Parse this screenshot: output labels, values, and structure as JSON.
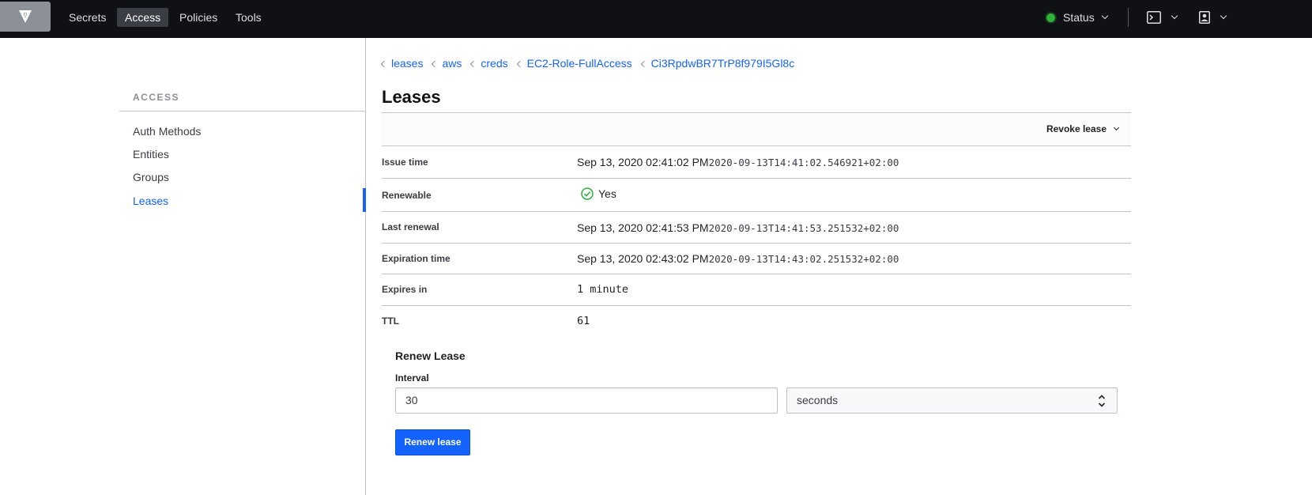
{
  "nav": {
    "links": [
      {
        "label": "Secrets"
      },
      {
        "label": "Access"
      },
      {
        "label": "Policies"
      },
      {
        "label": "Tools"
      }
    ],
    "active": "Access",
    "status_label": "Status",
    "status_color": "#2eb039",
    "icons": [
      "vault-logo-icon",
      "terminal-icon",
      "user-icon"
    ]
  },
  "sidebar": {
    "heading": "ACCESS",
    "items": [
      {
        "label": "Auth Methods"
      },
      {
        "label": "Entities"
      },
      {
        "label": "Groups"
      },
      {
        "label": "Leases"
      }
    ],
    "active": "Leases"
  },
  "breadcrumb": [
    {
      "label": "leases"
    },
    {
      "label": "aws"
    },
    {
      "label": "creds"
    },
    {
      "label": "EC2-Role-FullAccess"
    },
    {
      "label": "Ci3RpdwBR7TrP8f979I5Gl8c"
    }
  ],
  "page": {
    "title": "Leases",
    "revoke_label": "Revoke lease"
  },
  "details": {
    "issue_time": {
      "label": "Issue time",
      "value": "Sep 13, 2020 02:41:02 PM",
      "iso": "2020-09-13T14:41:02.546921+02:00"
    },
    "renewable": {
      "label": "Renewable",
      "value": "Yes"
    },
    "last_renewal": {
      "label": "Last renewal",
      "value": "Sep 13, 2020 02:41:53 PM",
      "iso": "2020-09-13T14:41:53.251532+02:00"
    },
    "expiration_time": {
      "label": "Expiration time",
      "value": "Sep 13, 2020 02:43:02 PM",
      "iso": "2020-09-13T14:43:02.251532+02:00"
    },
    "expires_in": {
      "label": "Expires in",
      "value": "1 minute"
    },
    "ttl": {
      "label": "TTL",
      "value": "61"
    }
  },
  "renew": {
    "heading": "Renew Lease",
    "interval_label": "Interval",
    "interval_value": "30",
    "unit_value": "seconds",
    "button_label": "Renew lease"
  },
  "colors": {
    "accent": "#1563ff",
    "success": "#2eb039",
    "nav_bg": "#0f1114"
  }
}
